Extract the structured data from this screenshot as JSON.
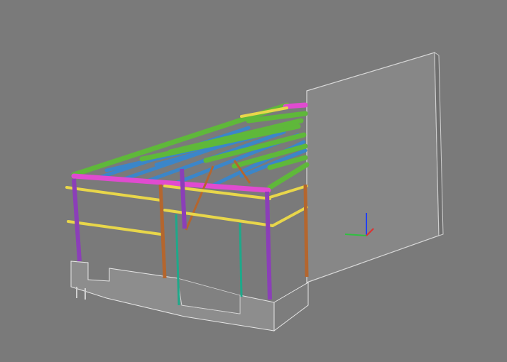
{
  "viewport": {
    "background": "#7a7a7a",
    "model_palette": {
      "beam_green": "#5fb83a",
      "beam_magenta": "#e04bd0",
      "purlin_blue": "#3b86c9",
      "girt_yellow": "#e8d64a",
      "column_purple": "#8b3fb8",
      "column_brown": "#b4662e",
      "mullion_teal": "#1ea98a",
      "wall_gray": "#8a8a8a"
    },
    "axis_triad": {
      "x_color": "#e03030",
      "y_color": "#30c040",
      "z_color": "#2040ff"
    }
  }
}
